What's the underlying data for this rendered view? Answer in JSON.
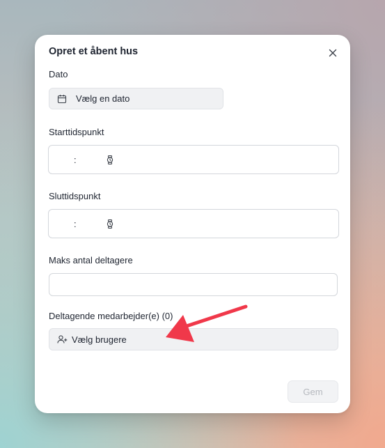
{
  "modal": {
    "title": "Opret et åbent hus",
    "close_icon": "close-icon"
  },
  "date": {
    "label": "Dato",
    "button_label": "Vælg en dato",
    "icon": "calendar-icon"
  },
  "start_time": {
    "label": "Starttidspunkt",
    "separator": ":",
    "icon": "clock-icon"
  },
  "end_time": {
    "label": "Sluttidspunkt",
    "separator": ":",
    "icon": "clock-icon"
  },
  "max_participants": {
    "label": "Maks antal deltagere",
    "value": ""
  },
  "employees": {
    "label": "Deltagende medarbejder(e) (0)",
    "button_label": "Vælg brugere",
    "icon": "user-plus-icon"
  },
  "actions": {
    "save_label": "Gem"
  },
  "colors": {
    "annotation_arrow": "#f0384a",
    "field_background": "#f0f1f3",
    "disabled_text": "#b5b8be"
  }
}
